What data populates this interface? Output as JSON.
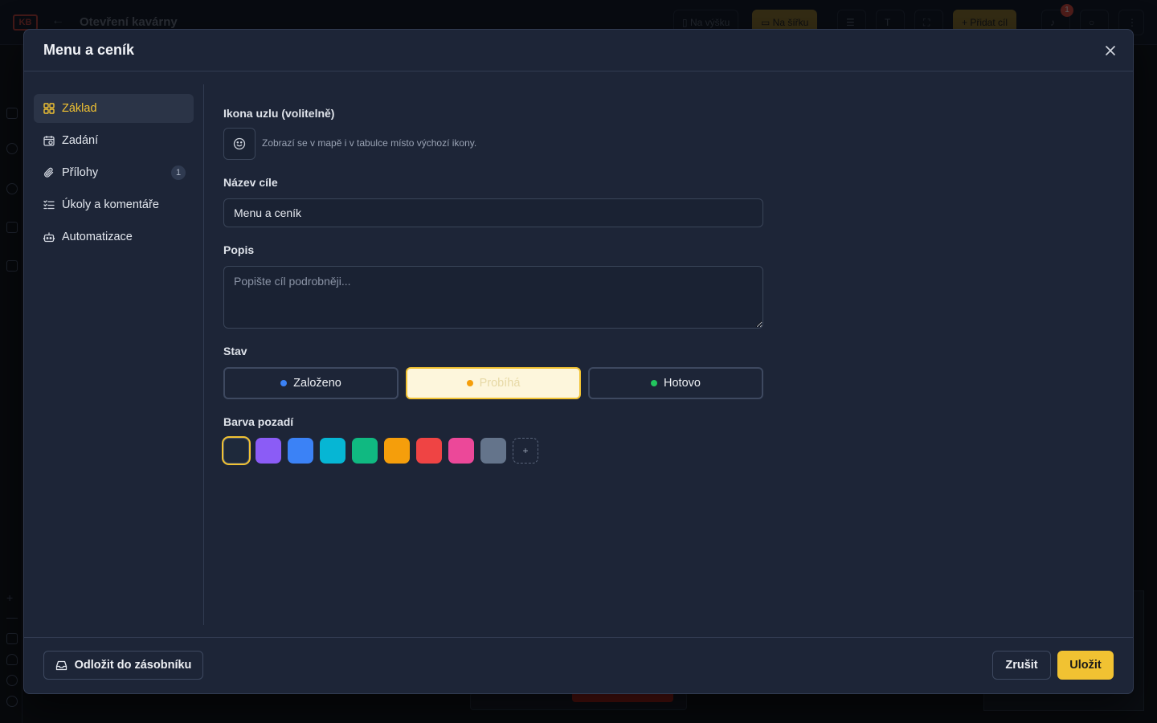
{
  "background": {
    "logo": "KB",
    "title": "Otevření kavárny",
    "buttons": {
      "portrait": "Na výšku",
      "landscape": "Na šířku",
      "add_goal": "Přidat cíl"
    },
    "notification_count": "1"
  },
  "modal": {
    "title": "Menu a ceník",
    "nav": [
      {
        "label": "Základ",
        "icon": "grid-icon",
        "active": true
      },
      {
        "label": "Zadání",
        "icon": "calendar-clock-icon"
      },
      {
        "label": "Přílohy",
        "icon": "paperclip-icon",
        "count": "1"
      },
      {
        "label": "Úkoly a komentáře",
        "icon": "list-check-icon"
      },
      {
        "label": "Automatizace",
        "icon": "robot-icon"
      }
    ],
    "icon_label": "Ikona uzlu (volitelně)",
    "icon_hint": "Zobrazí se v mapě i v tabulce místo výchozí ikony.",
    "name_label": "Název cíle",
    "name_value": "Menu a ceník",
    "description_label": "Popis",
    "description_placeholder": "Popište cíl podrobněji...",
    "status_label": "Stav",
    "statuses": [
      {
        "label": "Založeno",
        "color": "#3b82f6"
      },
      {
        "label": "Probíhá",
        "color": "#f59e0b",
        "selected": true
      },
      {
        "label": "Hotovo",
        "color": "#22c55e"
      }
    ],
    "bg_color_label": "Barva pozadí",
    "swatches": [
      "#1e293b",
      "#8b5cf6",
      "#3b82f6",
      "#06b6d4",
      "#10b981",
      "#f59e0b",
      "#ef4444",
      "#ec4899",
      "#64748b"
    ],
    "add_swatch_label": "+",
    "footer": {
      "stash_label": "Odložit do zásobníku",
      "cancel_label": "Zrušit",
      "save_label": "Uložit"
    }
  }
}
